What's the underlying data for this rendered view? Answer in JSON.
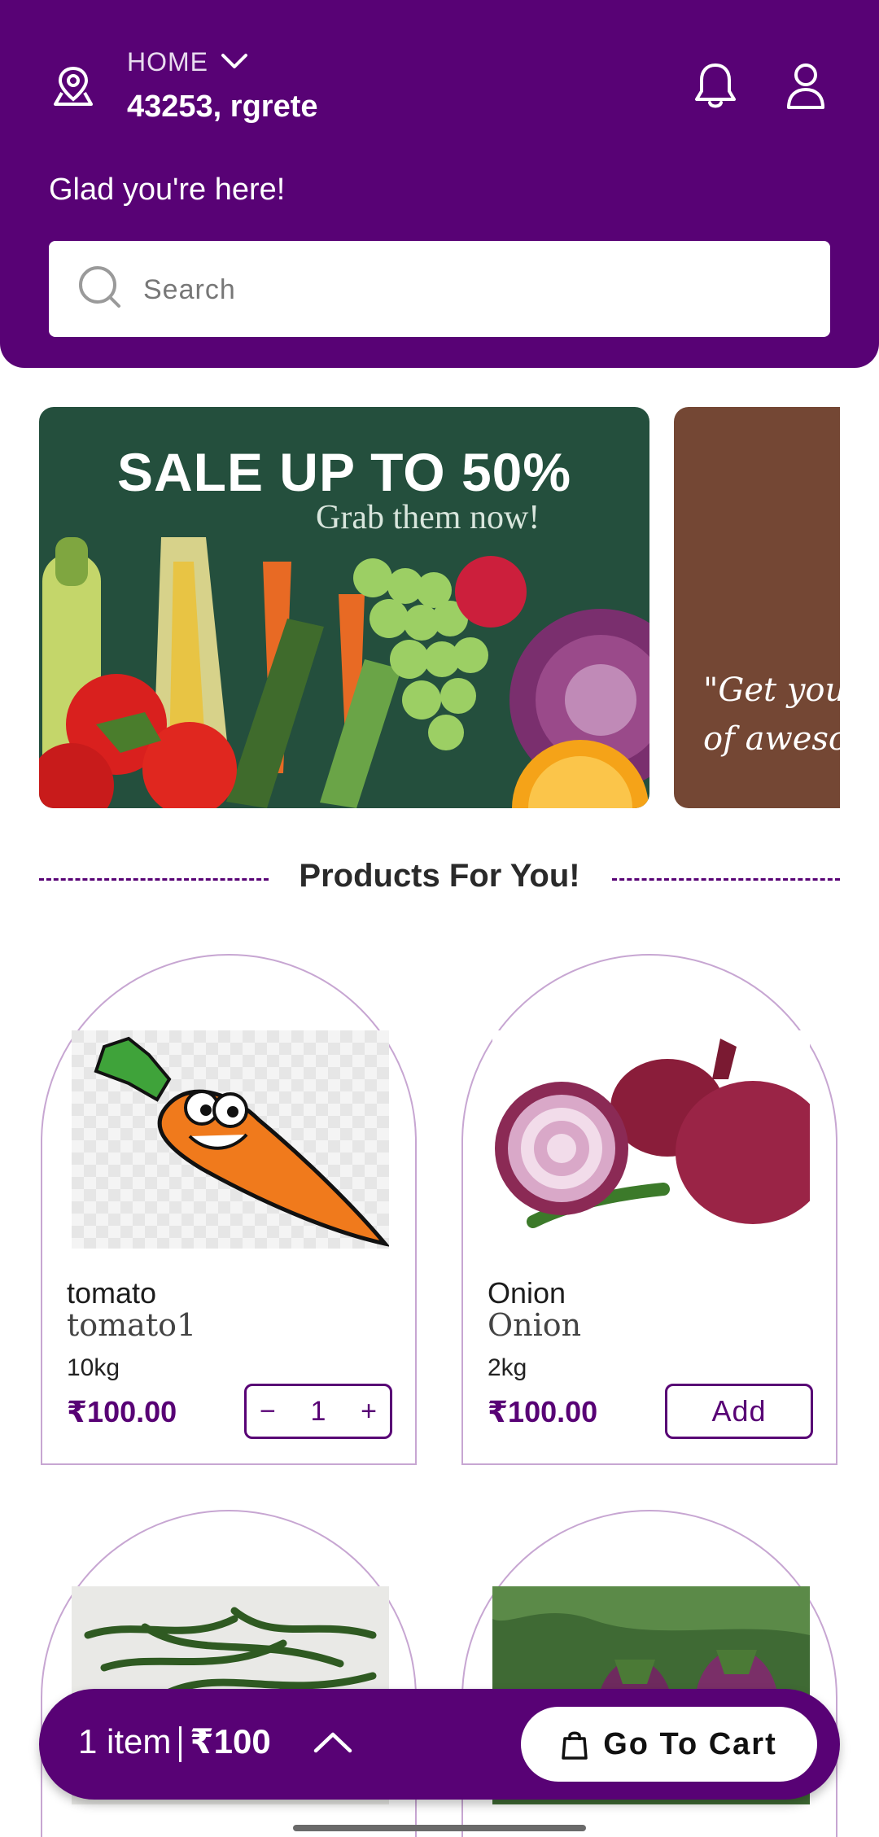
{
  "header": {
    "location_type": "HOME",
    "address": "43253, rgrete",
    "greeting": "Glad you're here!",
    "search_placeholder": "Search"
  },
  "banners": {
    "main_title": "SALE UP TO 50%",
    "main_subtitle": "Grab them now!",
    "second_text": "\"Get your\nof aweso"
  },
  "section": {
    "title": "Products For You!"
  },
  "products": [
    {
      "name": "tomato",
      "description": "tomato1",
      "quantity": "10kg",
      "price": "₹100.00",
      "stepper_minus": "−",
      "stepper_value": "1",
      "stepper_plus": "+"
    },
    {
      "name": "Onion",
      "description": "Onion",
      "quantity": "2kg",
      "price": "₹100.00",
      "add_label": "Add"
    }
  ],
  "cart": {
    "items": "1 item",
    "amount": "₹100",
    "button_label": "Go To Cart"
  },
  "colors": {
    "brand": "#580275",
    "card_border": "#c7a6d2",
    "banner_green": "#244f3d",
    "banner_brown": "#744734"
  },
  "icons": [
    "location-pin-icon",
    "chevron-down-icon",
    "bell-icon",
    "user-icon",
    "search-icon",
    "chevron-up-icon",
    "shopping-bag-icon"
  ]
}
